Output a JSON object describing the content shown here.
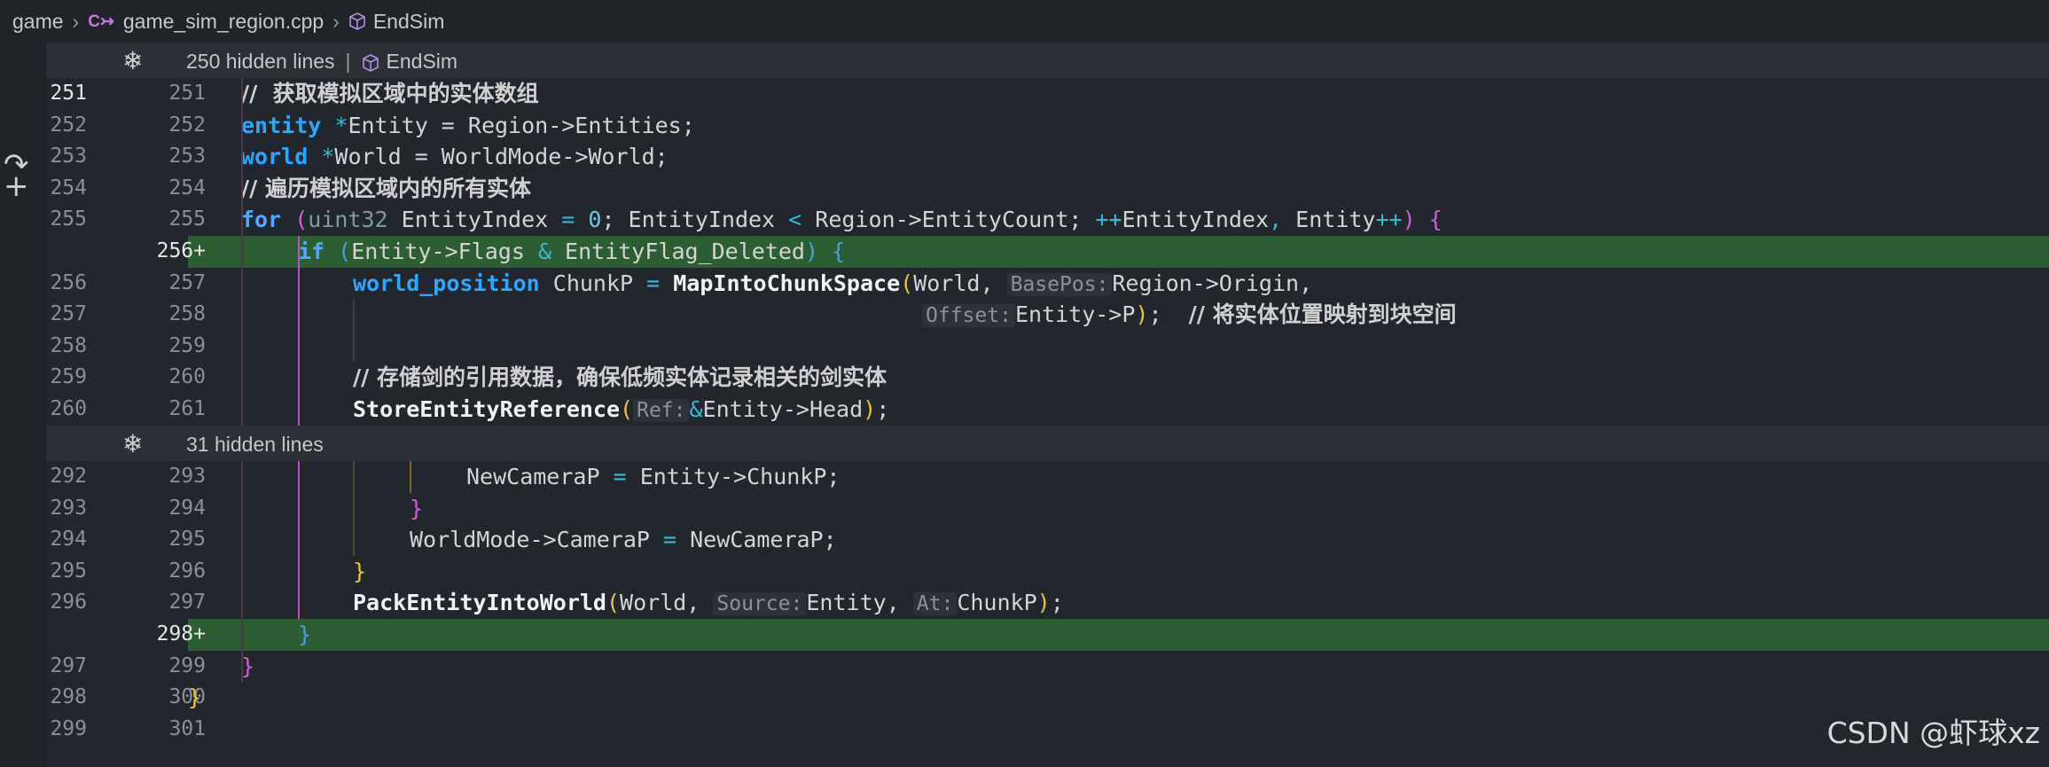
{
  "breadcrumb": {
    "folder": "game",
    "file": "game_sim_region.cpp",
    "file_icon": "C↣",
    "symbol": "EndSim"
  },
  "folds": [
    {
      "text": "250 hidden lines",
      "symbol": "EndSim"
    },
    {
      "text": "31 hidden lines"
    }
  ],
  "lines": [
    {
      "a": "251",
      "b": "251"
    },
    {
      "a": "252",
      "b": "252"
    },
    {
      "a": "253",
      "b": "253"
    },
    {
      "a": "254",
      "b": "254"
    },
    {
      "a": "255",
      "b": "255"
    },
    {
      "a": "",
      "b": "256+"
    },
    {
      "a": "256",
      "b": "257"
    },
    {
      "a": "257",
      "b": "258"
    },
    {
      "a": "258",
      "b": "259"
    },
    {
      "a": "259",
      "b": "260"
    },
    {
      "a": "260",
      "b": "261"
    },
    {
      "a": "292",
      "b": "293"
    },
    {
      "a": "293",
      "b": "294"
    },
    {
      "a": "294",
      "b": "295"
    },
    {
      "a": "295",
      "b": "296"
    },
    {
      "a": "296",
      "b": "297"
    },
    {
      "a": "",
      "b": "298+"
    },
    {
      "a": "297",
      "b": "299"
    },
    {
      "a": "298",
      "b": "300"
    },
    {
      "a": "299",
      "b": "301"
    }
  ],
  "code": {
    "l251_comment": "//  获取模拟区域中的实体数组",
    "l252": {
      "type": "entity",
      "star": "*",
      "rest": "Entity = Region->Entities;"
    },
    "l253": {
      "type": "world",
      "star": "*",
      "rest": "World = WorldMode->World;"
    },
    "l254_comment": "// 遍历模拟区域内的所有实体",
    "l255": {
      "kw": "for",
      "open": "(",
      "type": "uint32",
      "a": " EntityIndex ",
      "eq": "=",
      "zero": " 0",
      "b": "; EntityIndex ",
      "lt": "<",
      "c": " Region->EntityCount; ",
      "inc": "++",
      "d": "EntityIndex",
      "comma": ",",
      "e": " Entity",
      "inc2": "++",
      "close": ")",
      "brace": " {"
    },
    "l256": {
      "kw": "if",
      "open": " (",
      "a": "Entity->Flags ",
      "amp": "&",
      "b": " EntityFlag_Deleted",
      "close": ")",
      "brace": " {"
    },
    "l257": {
      "type": "world_position",
      "a": " ChunkP ",
      "eq": "=",
      "fn": " MapIntoChunkSpace",
      "open": "(",
      "b": "World,",
      "hint": "BasePos:",
      "c": "Region->Origin,"
    },
    "l258": {
      "hint": "Offset:",
      "a": "Entity->P",
      "close": ")",
      "b": ";  ",
      "comment": "// 将实体位置映射到块空间"
    },
    "l260_comment": "// 存储剑的引用数据，确保低频实体记录相关的剑实体",
    "l261": {
      "fn": "StoreEntityReference",
      "open": "(",
      "hint": "Ref:",
      "amp": "&",
      "a": "Entity->Head",
      "close": ")",
      "b": ";"
    },
    "l293": {
      "a": "NewCameraP ",
      "eq": "=",
      "b": " Entity->ChunkP;"
    },
    "l294": {
      "brace": "}"
    },
    "l295": {
      "a": "WorldMode->CameraP ",
      "eq": "=",
      "b": " NewCameraP;"
    },
    "l296": {
      "brace": "}"
    },
    "l297": {
      "fn": "PackEntityIntoWorld",
      "open": "(",
      "a": "World,",
      "hint1": "Source:",
      "b": "Entity,",
      "hint2": "At:",
      "c": "ChunkP",
      "close": ")",
      "d": ";"
    },
    "l298": {
      "brace": "}"
    },
    "l299": {
      "brace": "}"
    },
    "l300": {
      "brace": "}"
    }
  },
  "watermark": "CSDN @虾球xz",
  "colors": {
    "added_line": "#2d5e33",
    "keyword": "#4fa8ff",
    "bracket_yellow": "#e8c53d",
    "bracket_magenta": "#d65bd6",
    "bracket_blue": "#4a9ee0"
  }
}
